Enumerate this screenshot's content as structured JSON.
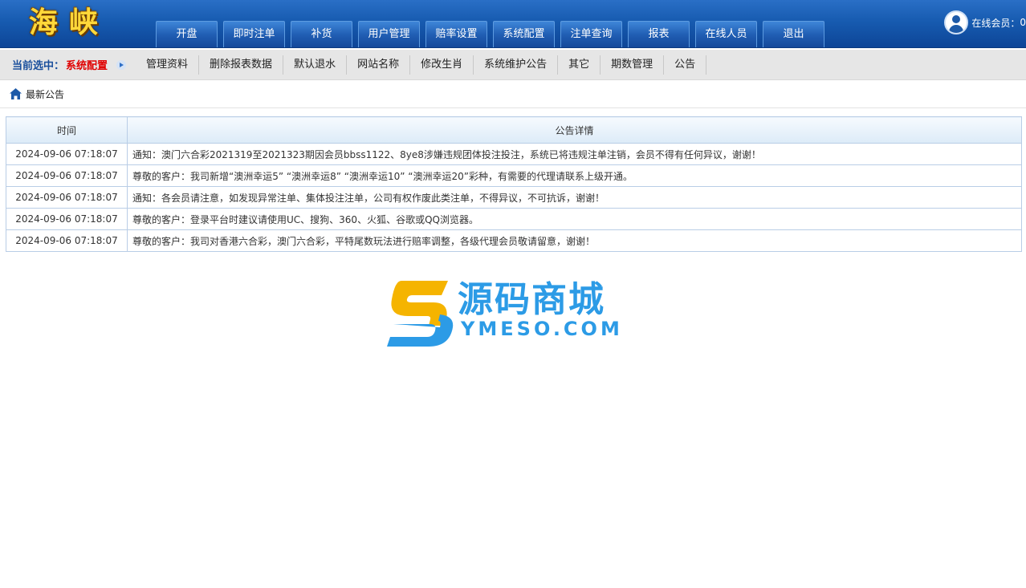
{
  "header": {
    "logo": "海峡",
    "nav": [
      "开盘",
      "即时注单",
      "补货",
      "用户管理",
      "赔率设置",
      "系统配置",
      "注单查询",
      "报表",
      "在线人员",
      "退出"
    ],
    "online_label": "在线会员：",
    "online_count": "0"
  },
  "subnav": {
    "current_label": "当前选中：",
    "current_value": "系统配置",
    "links": [
      "管理资料",
      "删除报表数据",
      "默认退水",
      "网站名称",
      "修改生肖",
      "系统维护公告",
      "其它",
      "期数管理",
      "公告"
    ]
  },
  "breadcrumb": {
    "title": "最新公告"
  },
  "table": {
    "headers": [
      "时间",
      "公告详情"
    ],
    "rows": [
      {
        "time": "2024-09-06 07:18:07",
        "text": "通知：澳门六合彩2021319至2021323期因会员bbss1122、8ye8涉嫌违规团体投注投注，系统已将违规注单注销，会员不得有任何异议，谢谢！"
      },
      {
        "time": "2024-09-06 07:18:07",
        "text": "尊敬的客户：我司新增“澳洲幸运5” “澳洲幸运8” “澳洲幸运10” “澳洲幸运20”彩种，有需要的代理请联系上级开通。"
      },
      {
        "time": "2024-09-06 07:18:07",
        "text": "通知：各会员请注意，如发现异常注单、集体投注注单，公司有权作废此类注单，不得异议，不可抗诉，谢谢！"
      },
      {
        "time": "2024-09-06 07:18:07",
        "text": "尊敬的客户：登录平台时建议请使用UC、搜狗、360、火狐、谷歌或QQ浏览器。"
      },
      {
        "time": "2024-09-06 07:18:07",
        "text": "尊敬的客户：我司对香港六合彩，澳门六合彩，平特尾数玩法进行赔率调整，各级代理会员敬请留意，谢谢！"
      }
    ]
  },
  "watermark": {
    "cn": "源码商城",
    "en": "YMESO.COM"
  },
  "colors": {
    "header_blue": "#175bb0",
    "accent_red": "#e00000",
    "accent_navy": "#1a4f9c"
  }
}
